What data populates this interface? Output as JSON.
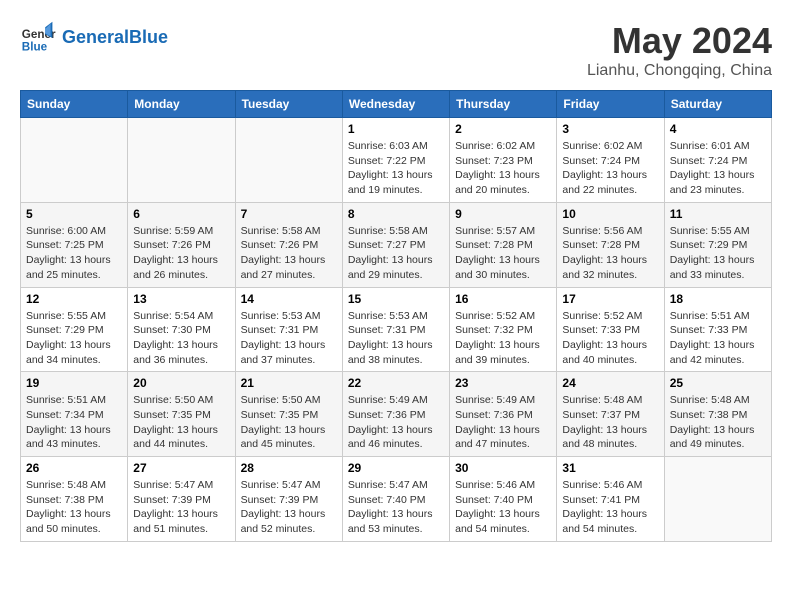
{
  "logo": {
    "line1": "General",
    "line2": "Blue"
  },
  "title": "May 2024",
  "location": "Lianhu, Chongqing, China",
  "days_of_week": [
    "Sunday",
    "Monday",
    "Tuesday",
    "Wednesday",
    "Thursday",
    "Friday",
    "Saturday"
  ],
  "weeks": [
    [
      {
        "day": "",
        "info": ""
      },
      {
        "day": "",
        "info": ""
      },
      {
        "day": "",
        "info": ""
      },
      {
        "day": "1",
        "info": "Sunrise: 6:03 AM\nSunset: 7:22 PM\nDaylight: 13 hours and 19 minutes."
      },
      {
        "day": "2",
        "info": "Sunrise: 6:02 AM\nSunset: 7:23 PM\nDaylight: 13 hours and 20 minutes."
      },
      {
        "day": "3",
        "info": "Sunrise: 6:02 AM\nSunset: 7:24 PM\nDaylight: 13 hours and 22 minutes."
      },
      {
        "day": "4",
        "info": "Sunrise: 6:01 AM\nSunset: 7:24 PM\nDaylight: 13 hours and 23 minutes."
      }
    ],
    [
      {
        "day": "5",
        "info": "Sunrise: 6:00 AM\nSunset: 7:25 PM\nDaylight: 13 hours and 25 minutes."
      },
      {
        "day": "6",
        "info": "Sunrise: 5:59 AM\nSunset: 7:26 PM\nDaylight: 13 hours and 26 minutes."
      },
      {
        "day": "7",
        "info": "Sunrise: 5:58 AM\nSunset: 7:26 PM\nDaylight: 13 hours and 27 minutes."
      },
      {
        "day": "8",
        "info": "Sunrise: 5:58 AM\nSunset: 7:27 PM\nDaylight: 13 hours and 29 minutes."
      },
      {
        "day": "9",
        "info": "Sunrise: 5:57 AM\nSunset: 7:28 PM\nDaylight: 13 hours and 30 minutes."
      },
      {
        "day": "10",
        "info": "Sunrise: 5:56 AM\nSunset: 7:28 PM\nDaylight: 13 hours and 32 minutes."
      },
      {
        "day": "11",
        "info": "Sunrise: 5:55 AM\nSunset: 7:29 PM\nDaylight: 13 hours and 33 minutes."
      }
    ],
    [
      {
        "day": "12",
        "info": "Sunrise: 5:55 AM\nSunset: 7:29 PM\nDaylight: 13 hours and 34 minutes."
      },
      {
        "day": "13",
        "info": "Sunrise: 5:54 AM\nSunset: 7:30 PM\nDaylight: 13 hours and 36 minutes."
      },
      {
        "day": "14",
        "info": "Sunrise: 5:53 AM\nSunset: 7:31 PM\nDaylight: 13 hours and 37 minutes."
      },
      {
        "day": "15",
        "info": "Sunrise: 5:53 AM\nSunset: 7:31 PM\nDaylight: 13 hours and 38 minutes."
      },
      {
        "day": "16",
        "info": "Sunrise: 5:52 AM\nSunset: 7:32 PM\nDaylight: 13 hours and 39 minutes."
      },
      {
        "day": "17",
        "info": "Sunrise: 5:52 AM\nSunset: 7:33 PM\nDaylight: 13 hours and 40 minutes."
      },
      {
        "day": "18",
        "info": "Sunrise: 5:51 AM\nSunset: 7:33 PM\nDaylight: 13 hours and 42 minutes."
      }
    ],
    [
      {
        "day": "19",
        "info": "Sunrise: 5:51 AM\nSunset: 7:34 PM\nDaylight: 13 hours and 43 minutes."
      },
      {
        "day": "20",
        "info": "Sunrise: 5:50 AM\nSunset: 7:35 PM\nDaylight: 13 hours and 44 minutes."
      },
      {
        "day": "21",
        "info": "Sunrise: 5:50 AM\nSunset: 7:35 PM\nDaylight: 13 hours and 45 minutes."
      },
      {
        "day": "22",
        "info": "Sunrise: 5:49 AM\nSunset: 7:36 PM\nDaylight: 13 hours and 46 minutes."
      },
      {
        "day": "23",
        "info": "Sunrise: 5:49 AM\nSunset: 7:36 PM\nDaylight: 13 hours and 47 minutes."
      },
      {
        "day": "24",
        "info": "Sunrise: 5:48 AM\nSunset: 7:37 PM\nDaylight: 13 hours and 48 minutes."
      },
      {
        "day": "25",
        "info": "Sunrise: 5:48 AM\nSunset: 7:38 PM\nDaylight: 13 hours and 49 minutes."
      }
    ],
    [
      {
        "day": "26",
        "info": "Sunrise: 5:48 AM\nSunset: 7:38 PM\nDaylight: 13 hours and 50 minutes."
      },
      {
        "day": "27",
        "info": "Sunrise: 5:47 AM\nSunset: 7:39 PM\nDaylight: 13 hours and 51 minutes."
      },
      {
        "day": "28",
        "info": "Sunrise: 5:47 AM\nSunset: 7:39 PM\nDaylight: 13 hours and 52 minutes."
      },
      {
        "day": "29",
        "info": "Sunrise: 5:47 AM\nSunset: 7:40 PM\nDaylight: 13 hours and 53 minutes."
      },
      {
        "day": "30",
        "info": "Sunrise: 5:46 AM\nSunset: 7:40 PM\nDaylight: 13 hours and 54 minutes."
      },
      {
        "day": "31",
        "info": "Sunrise: 5:46 AM\nSunset: 7:41 PM\nDaylight: 13 hours and 54 minutes."
      },
      {
        "day": "",
        "info": ""
      }
    ]
  ]
}
